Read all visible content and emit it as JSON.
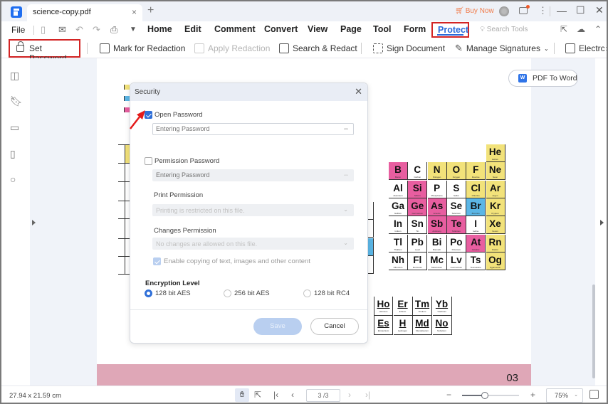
{
  "titlebar": {
    "tab_title": "science-copy.pdf",
    "tab_close": "×",
    "new_tab": "+",
    "buy_now": "Buy Now",
    "kebab": "⋮",
    "minimize": "—",
    "maximize": "☐",
    "close": "✕"
  },
  "menubar": {
    "file": "File",
    "items": [
      "Home",
      "Edit",
      "Comment",
      "Convert",
      "View",
      "Page",
      "Tool",
      "Form",
      "Protect"
    ],
    "active": "Protect",
    "search_tools": "Search Tools"
  },
  "toolbar": {
    "set_password": "Set Password",
    "mark_for_redaction": "Mark for Redaction",
    "apply_redaction": "Apply Redaction",
    "search_redact": "Search & Redact",
    "sign_document": "Sign Document",
    "manage_signatures": "Manage Signatures",
    "electronic": "Electrc",
    "more": "›"
  },
  "pdf_to_word": {
    "label": "PDF To Word",
    "badge": "W"
  },
  "page": {
    "number": "03"
  },
  "periodic_table": {
    "main": [
      [
        null,
        null,
        null,
        null,
        null,
        {
          "s": "He",
          "n": "Helium",
          "c": "yellow"
        }
      ],
      [
        {
          "s": "B",
          "n": "Boron",
          "c": "pink"
        },
        {
          "s": "C",
          "n": "Carbon",
          "c": "white"
        },
        {
          "s": "N",
          "n": "Nitrogen",
          "c": "yellow"
        },
        {
          "s": "O",
          "n": "Oxygen",
          "c": "yellow"
        },
        {
          "s": "F",
          "n": "Fluorine",
          "c": "yellow"
        },
        {
          "s": "Ne",
          "n": "Neon",
          "c": "yellow"
        }
      ],
      [
        {
          "s": "Al",
          "n": "Aluminum",
          "c": "white"
        },
        {
          "s": "Si",
          "n": "Silicon",
          "c": "pink"
        },
        {
          "s": "P",
          "n": "Phosphorus",
          "c": "white"
        },
        {
          "s": "S",
          "n": "Sulfur",
          "c": "white"
        },
        {
          "s": "Cl",
          "n": "Chlorine",
          "c": "yellow"
        },
        {
          "s": "Ar",
          "n": "Argon",
          "c": "yellow"
        }
      ],
      [
        {
          "s": "Ga",
          "n": "Gallium",
          "c": "white"
        },
        {
          "s": "Ge",
          "n": "Germanium",
          "c": "pink"
        },
        {
          "s": "As",
          "n": "Arsenic",
          "c": "pink"
        },
        {
          "s": "Se",
          "n": "Selenium",
          "c": "white"
        },
        {
          "s": "Br",
          "n": "Bromine",
          "c": "blue"
        },
        {
          "s": "Kr",
          "n": "Krypton",
          "c": "yellow"
        }
      ],
      [
        {
          "s": "In",
          "n": "Indium",
          "c": "white"
        },
        {
          "s": "Sn",
          "n": "Tin",
          "c": "white"
        },
        {
          "s": "Sb",
          "n": "Antimony",
          "c": "pink"
        },
        {
          "s": "Te",
          "n": "Tellurium",
          "c": "pink"
        },
        {
          "s": "I",
          "n": "Iodine",
          "c": "white"
        },
        {
          "s": "Xe",
          "n": "Xenon",
          "c": "yellow"
        }
      ],
      [
        {
          "s": "Tl",
          "n": "Thallium",
          "c": "white"
        },
        {
          "s": "Pb",
          "n": "Lead",
          "c": "white"
        },
        {
          "s": "Bi",
          "n": "Bismuth",
          "c": "white"
        },
        {
          "s": "Po",
          "n": "Polonium",
          "c": "white"
        },
        {
          "s": "At",
          "n": "Astatine",
          "c": "pink"
        },
        {
          "s": "Rn",
          "n": "Radon",
          "c": "yellow"
        }
      ],
      [
        {
          "s": "Nh",
          "n": "Nihonium",
          "c": "white"
        },
        {
          "s": "Fl",
          "n": "Flerovium",
          "c": "white"
        },
        {
          "s": "Mc",
          "n": "Moscovium",
          "c": "white"
        },
        {
          "s": "Lv",
          "n": "Livermorium",
          "c": "white"
        },
        {
          "s": "Ts",
          "n": "Tennessine",
          "c": "white"
        },
        {
          "s": "Og",
          "n": "Oganesson",
          "c": "yellow"
        }
      ]
    ],
    "bottom": [
      [
        {
          "s": "Ho",
          "n": "Holmium"
        },
        {
          "s": "Er",
          "n": "Erbium"
        },
        {
          "s": "Tm",
          "n": "Thulium"
        },
        {
          "s": "Yb",
          "n": "Ytterbium"
        }
      ],
      [
        {
          "s": "Es",
          "n": "Einsteinium"
        },
        {
          "s": "H",
          "n": "Hydrogen"
        },
        {
          "s": "Md",
          "n": "Mendelevium"
        },
        {
          "s": "No",
          "n": "Nobelium"
        }
      ]
    ],
    "colors": {
      "pink": "#e85ea0",
      "yellow": "#f2e27a",
      "blue": "#5bb6e6",
      "white": "#ffffff"
    }
  },
  "dialog": {
    "title": "Security",
    "open_password": {
      "label": "Open Password",
      "checked": true,
      "placeholder": "Entering Password",
      "value": ""
    },
    "permission_password": {
      "label": "Permission Password",
      "checked": false,
      "placeholder": "Entering Password"
    },
    "print_permission": {
      "label": "Print Permission",
      "value": "Printing is restricted on this file."
    },
    "changes_permission": {
      "label": "Changes Permission",
      "value": "No changes are allowed on this file."
    },
    "enable_copying": {
      "label": "Enable copying of text, images and other content",
      "checked": true
    },
    "encryption": {
      "title": "Encryption Level",
      "options": [
        "128 bit AES",
        "256 bit AES",
        "128 bit RC4"
      ],
      "selected": "128 bit AES"
    },
    "save": "Save",
    "cancel": "Cancel"
  },
  "statusbar": {
    "dimensions": "27.94 x 21.59 cm",
    "page_indicator": "3 /3",
    "zoom": "75%",
    "zoom_level_fraction": 0.4
  },
  "colors": {
    "accent": "#2f6fd8",
    "highlight_red": "#d32424",
    "buy_now": "#f07b4a",
    "footer_band": "#dfa7b7"
  }
}
